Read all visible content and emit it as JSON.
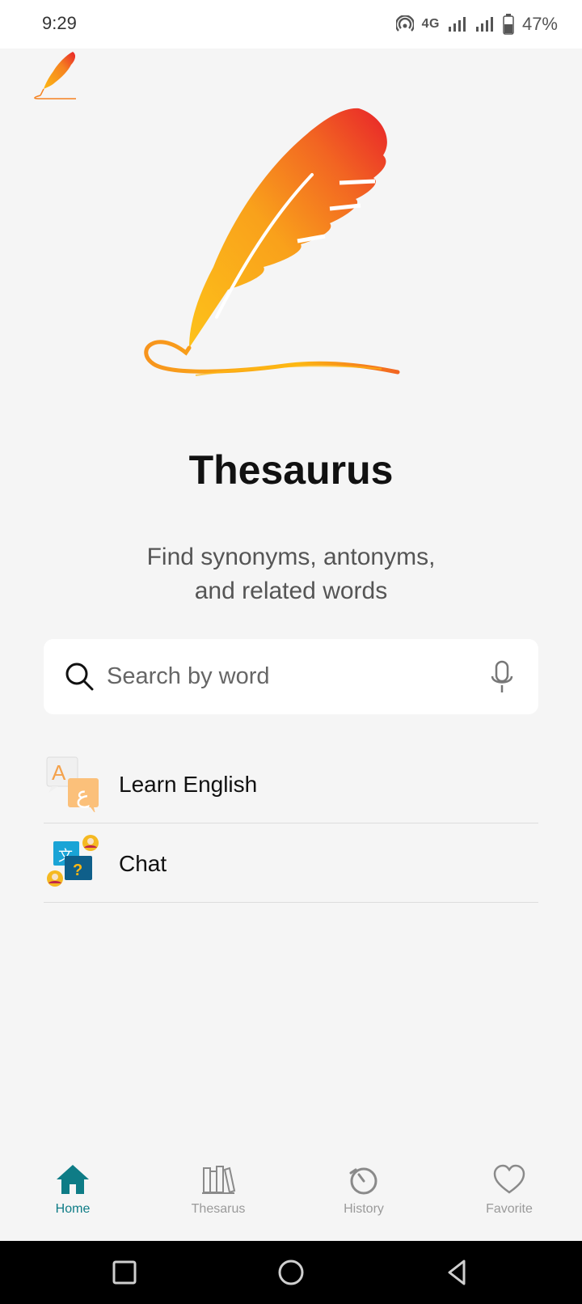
{
  "status_bar": {
    "time": "9:29",
    "network": "4G",
    "battery_percent": "47%",
    "icons": [
      "hotspot-icon",
      "signal-icon",
      "signal-icon",
      "battery-icon"
    ]
  },
  "app": {
    "title": "Thesaurus",
    "subtitle_line1": "Find synonyms, antonyms,",
    "subtitle_line2": "and related words",
    "accent_color": "#0e7c86",
    "feather_colors": [
      "#e8232a",
      "#f58220",
      "#fdb813"
    ]
  },
  "search": {
    "placeholder": "Search by word",
    "value": ""
  },
  "menu": {
    "items": [
      {
        "label": "Learn English",
        "icon": "learn-english-icon"
      },
      {
        "label": "Chat",
        "icon": "chat-translate-icon"
      }
    ]
  },
  "bottom_nav": {
    "items": [
      {
        "label": "Home",
        "icon": "home-icon",
        "active": true
      },
      {
        "label": "Thesarus",
        "icon": "books-icon",
        "active": false
      },
      {
        "label": "History",
        "icon": "history-icon",
        "active": false
      },
      {
        "label": "Favorite",
        "icon": "heart-icon",
        "active": false
      }
    ]
  }
}
